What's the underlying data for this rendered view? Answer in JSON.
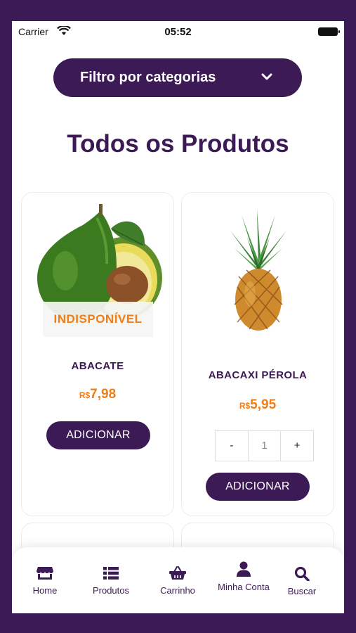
{
  "status_bar": {
    "carrier": "Carrier",
    "time": "05:52"
  },
  "filter": {
    "label": "Filtro por categorias",
    "icon": "chevron-down-icon"
  },
  "page_title": "Todos os Produtos",
  "products": [
    {
      "name": "ABACATE",
      "currency": "R$",
      "price": "7,98",
      "badge": "INDISPONÍVEL",
      "add_label": "ADICIONAR"
    },
    {
      "name": "ABACAXI PÉROLA",
      "currency": "R$",
      "price": "5,95",
      "quantity": "1",
      "minus": "-",
      "plus": "+",
      "add_label": "ADICIONAR"
    }
  ],
  "tabs": [
    {
      "label": "Home",
      "icon": "store-icon"
    },
    {
      "label": "Produtos",
      "icon": "list-icon"
    },
    {
      "label": "Carrinho",
      "icon": "basket-icon"
    },
    {
      "label": "Minha Conta",
      "icon": "user-icon"
    },
    {
      "label": "Buscar",
      "icon": "search-icon"
    }
  ],
  "colors": {
    "primary": "#3b1a55",
    "accent": "#f07d15",
    "background": "#ffffff"
  }
}
